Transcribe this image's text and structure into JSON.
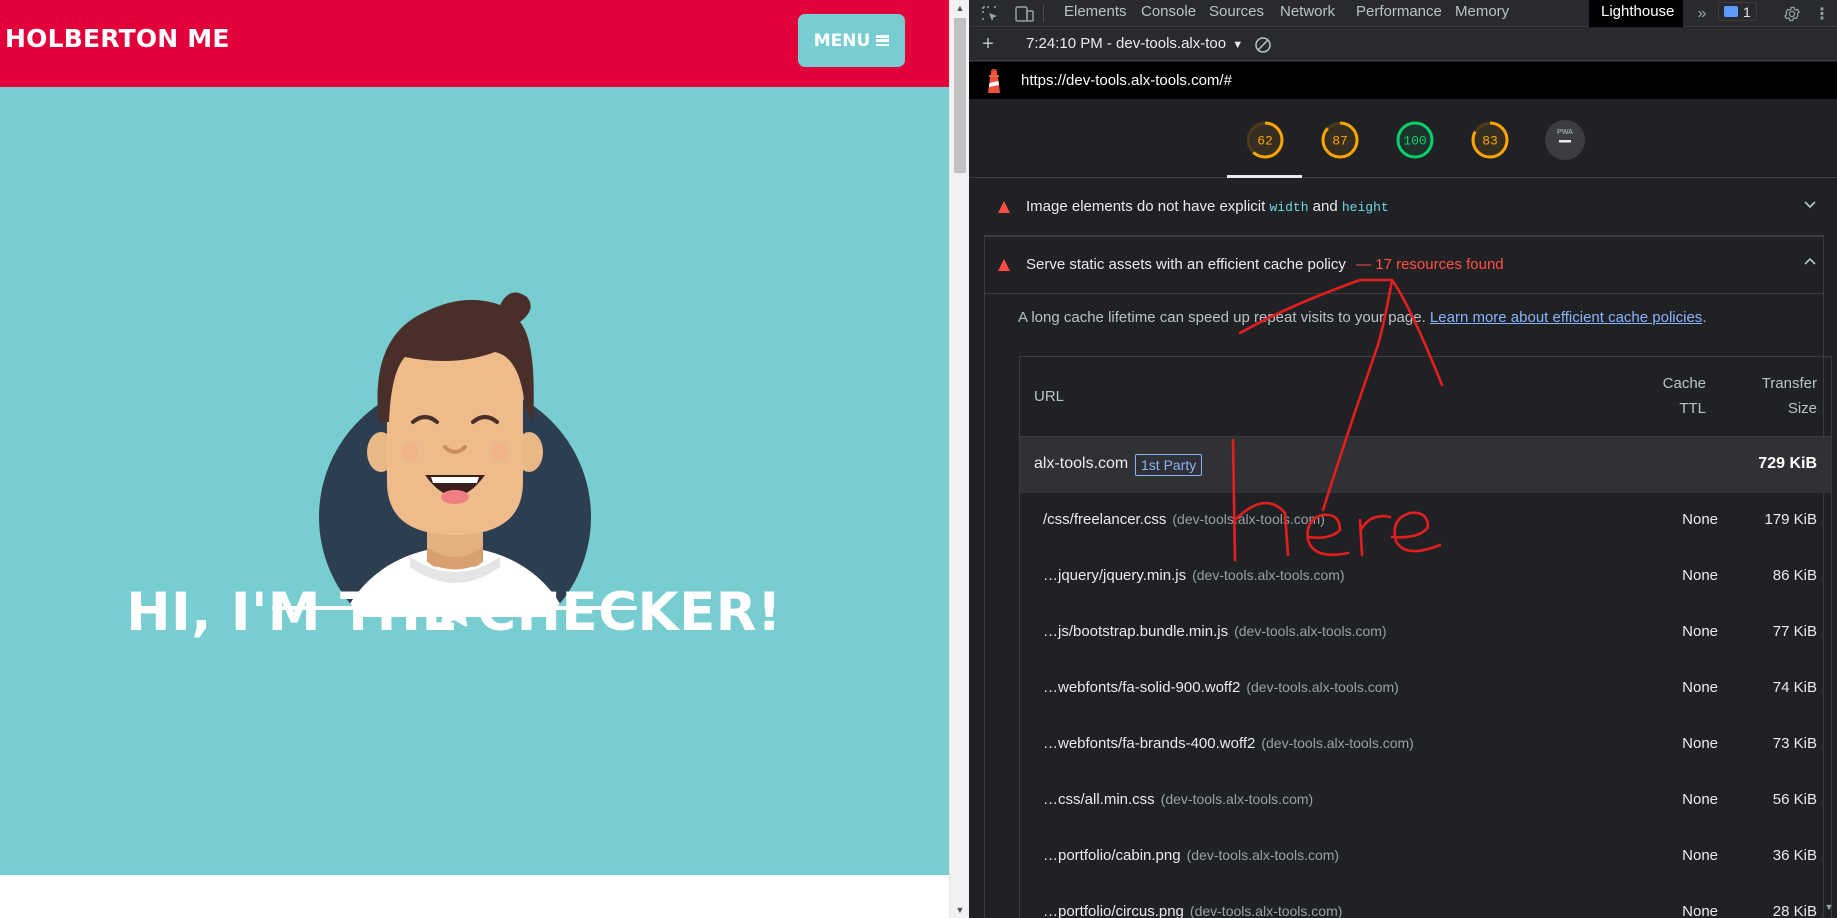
{
  "site": {
    "brand": "HOLBERTON ME",
    "menu_label": "MENU",
    "hero_title": "HI, I'M THE CHECKER!",
    "colors": {
      "nav": "#e2003b",
      "hero": "#78cdd1"
    }
  },
  "devtools": {
    "tabs": [
      {
        "label": "Elements"
      },
      {
        "label": "Console"
      },
      {
        "label": "Sources"
      },
      {
        "label": "Network"
      },
      {
        "label": "Performance"
      },
      {
        "label": "Memory"
      },
      {
        "label": "Lighthouse"
      }
    ],
    "issues_count": "1",
    "report_selector": "7:24:10 PM - dev-tools.alx-too",
    "report_url": "https://dev-tools.alx-tools.com/#",
    "scores": [
      {
        "value": "62",
        "color": "#ffa400",
        "fraction": 0.62
      },
      {
        "value": "87",
        "color": "#ffa400",
        "fraction": 0.87
      },
      {
        "value": "100",
        "color": "#0cce6b",
        "fraction": 1.0
      },
      {
        "value": "83",
        "color": "#ffa400",
        "fraction": 0.83
      }
    ],
    "pwa_label": "PWA",
    "audit_images": {
      "title_prefix": "Image elements do not have explicit",
      "code_width": "width",
      "and_word": "and",
      "code_height": "height"
    },
    "audit_cache": {
      "title": "Serve static assets with an efficient cache policy",
      "summary": "— 17 resources found",
      "description": "A long cache lifetime can speed up repeat visits to your page.",
      "learn_more": "Learn more about efficient cache policies",
      "learn_more_suffix": "."
    },
    "table": {
      "col_url": "URL",
      "col_ttl_1": "Cache",
      "col_ttl_2": "TTL",
      "col_size_1": "Transfer",
      "col_size_2": "Size",
      "group": {
        "domain": "alx-tools.com",
        "tag": "1st Party",
        "total": "729 KiB"
      },
      "rows": [
        {
          "path": "/css/freelancer.css",
          "host": "(dev-tools.alx-tools.com)",
          "ttl": "None",
          "size": "179 KiB"
        },
        {
          "path": "…jquery/jquery.min.js",
          "host": "(dev-tools.alx-tools.com)",
          "ttl": "None",
          "size": "86 KiB"
        },
        {
          "path": "…js/bootstrap.bundle.min.js",
          "host": "(dev-tools.alx-tools.com)",
          "ttl": "None",
          "size": "77 KiB"
        },
        {
          "path": "…webfonts/fa-solid-900.woff2",
          "host": "(dev-tools.alx-tools.com)",
          "ttl": "None",
          "size": "74 KiB"
        },
        {
          "path": "…webfonts/fa-brands-400.woff2",
          "host": "(dev-tools.alx-tools.com)",
          "ttl": "None",
          "size": "73 KiB"
        },
        {
          "path": "…css/all.min.css",
          "host": "(dev-tools.alx-tools.com)",
          "ttl": "None",
          "size": "56 KiB"
        },
        {
          "path": "…portfolio/cabin.png",
          "host": "(dev-tools.alx-tools.com)",
          "ttl": "None",
          "size": "36 KiB"
        },
        {
          "path": "…portfolio/circus.png",
          "host": "(dev-tools.alx-tools.com)",
          "ttl": "None",
          "size": "28 KiB"
        }
      ]
    }
  },
  "annotation": {
    "text": "here",
    "color": "#e41e1e"
  }
}
